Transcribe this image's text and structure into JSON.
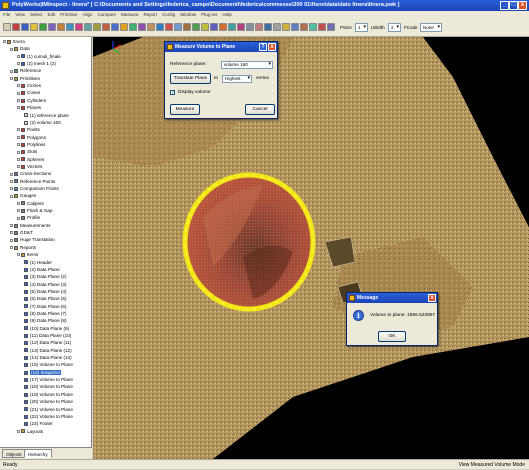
{
  "window": {
    "title": "PolyWorks|IMInspect - Itnera* [ C:\\Documents and Settings\\federica_campo\\Documenti\\federica\\commesse\\300 01\\fisno\\data\\dato Itnera\\Itnera.pwk ]",
    "minimize": "_",
    "maximize": "□",
    "close": "x"
  },
  "menu": [
    "File",
    "View",
    "Select",
    "Edit",
    "Primitive",
    "Align",
    "Compare",
    "Measure",
    "Report",
    "Config",
    "Window",
    "Plug-ins",
    "Help"
  ],
  "toolbar": {
    "psize_label": "PSize",
    "psize_value": "1",
    "lwidth_label": "LWidth",
    "lwidth_value": "2",
    "fcode_label": "FCode",
    "fcode_value": "None"
  },
  "tree": [
    {
      "label": "Itnera",
      "level": 0,
      "icon": "folder-icon",
      "color": "#c8a040"
    },
    {
      "label": "Data",
      "level": 1,
      "icon": "folder-icon",
      "color": "#c8a040"
    },
    {
      "label": "(1) cumuli_finale",
      "level": 2,
      "icon": "mesh-icon",
      "color": "#4060c0"
    },
    {
      "label": "(2) mesh 1 (2)",
      "level": 2,
      "icon": "mesh-icon",
      "color": "#4060c0"
    },
    {
      "label": "Reference",
      "level": 1,
      "icon": "reference-icon",
      "color": "#60a060"
    },
    {
      "label": "Primitives",
      "level": 1,
      "icon": "folder-icon",
      "color": "#c8a040"
    },
    {
      "label": "Circles",
      "level": 2,
      "icon": "circle-icon",
      "color": "#c04040"
    },
    {
      "label": "Cones",
      "level": 2,
      "icon": "cone-icon",
      "color": "#c04040"
    },
    {
      "label": "Cylinders",
      "level": 2,
      "icon": "cylinder-icon",
      "color": "#c04040"
    },
    {
      "label": "Planes",
      "level": 2,
      "icon": "plane-icon",
      "color": "#c04040"
    },
    {
      "label": "(1) reference plane",
      "level": 3,
      "icon": "plane-item-icon",
      "color": "#d8d8d8"
    },
    {
      "label": "(2) volume 160",
      "level": 3,
      "icon": "plane-item-icon",
      "color": "#d8d8d8"
    },
    {
      "label": "Points",
      "level": 2,
      "icon": "point-icon",
      "color": "#c04040"
    },
    {
      "label": "Polygons",
      "level": 2,
      "icon": "polygon-icon",
      "color": "#c04040"
    },
    {
      "label": "Polylines",
      "level": 2,
      "icon": "polyline-icon",
      "color": "#c04040"
    },
    {
      "label": "Slots",
      "level": 2,
      "icon": "slot-icon",
      "color": "#c04040"
    },
    {
      "label": "Spheres",
      "level": 2,
      "icon": "sphere-icon",
      "color": "#c04040"
    },
    {
      "label": "Vectors",
      "level": 2,
      "icon": "vector-icon",
      "color": "#c04040"
    },
    {
      "label": "Cross-Sections",
      "level": 1,
      "icon": "cross-section-icon",
      "color": "#4080c0"
    },
    {
      "label": "Reference Points",
      "level": 1,
      "icon": "reference-points-icon",
      "color": "#4080c0"
    },
    {
      "label": "Comparison Points",
      "level": 1,
      "icon": "comparison-points-icon",
      "color": "#4080c0"
    },
    {
      "label": "Gauges",
      "level": 1,
      "icon": "folder-icon",
      "color": "#c8a040"
    },
    {
      "label": "Calipers",
      "level": 2,
      "icon": "caliper-icon",
      "color": "#808080"
    },
    {
      "label": "Flush & Gap",
      "level": 2,
      "icon": "flush-gap-icon",
      "color": "#808080"
    },
    {
      "label": "Profile",
      "level": 2,
      "icon": "profile-icon",
      "color": "#808080"
    },
    {
      "label": "Measurements",
      "level": 1,
      "icon": "measurement-icon",
      "color": "#808080"
    },
    {
      "label": "GD&T",
      "level": 1,
      "icon": "gdt-icon",
      "color": "#808080"
    },
    {
      "label": "Huge Translation",
      "level": 1,
      "icon": "translation-icon",
      "color": "#808080"
    },
    {
      "label": "Reports",
      "level": 1,
      "icon": "folder-icon",
      "color": "#c8a040"
    },
    {
      "label": "Items",
      "level": 2,
      "icon": "folder-icon",
      "color": "#c8a040"
    },
    {
      "label": "(1) Header",
      "level": 3,
      "icon": "report-item-icon",
      "color": "#4060c0"
    },
    {
      "label": "(2) Data Plane",
      "level": 3,
      "icon": "report-item-icon",
      "color": "#4060c0"
    },
    {
      "label": "(3) Data Plane (2)",
      "level": 3,
      "icon": "report-item-icon",
      "color": "#4060c0"
    },
    {
      "label": "(4) Data Plane (3)",
      "level": 3,
      "icon": "report-item-icon",
      "color": "#4060c0"
    },
    {
      "label": "(5) Data Plane (4)",
      "level": 3,
      "icon": "report-item-icon",
      "color": "#4060c0"
    },
    {
      "label": "(6) Data Plane (5)",
      "level": 3,
      "icon": "report-item-icon",
      "color": "#4060c0"
    },
    {
      "label": "(7) Data Plane (6)",
      "level": 3,
      "icon": "report-item-icon",
      "color": "#4060c0"
    },
    {
      "label": "(8) Data Plane (7)",
      "level": 3,
      "icon": "report-item-icon",
      "color": "#4060c0"
    },
    {
      "label": "(9) Data Plane (8)",
      "level": 3,
      "icon": "report-item-icon",
      "color": "#4060c0"
    },
    {
      "label": "(10) Data Plane (9)",
      "level": 3,
      "icon": "report-item-icon",
      "color": "#4060c0"
    },
    {
      "label": "(11) Data Plane (10)",
      "level": 3,
      "icon": "report-item-icon",
      "color": "#4060c0"
    },
    {
      "label": "(12) Data Plane (11)",
      "level": 3,
      "icon": "report-item-icon",
      "color": "#4060c0"
    },
    {
      "label": "(13) Data Plane (12)",
      "level": 3,
      "icon": "report-item-icon",
      "color": "#4060c0"
    },
    {
      "label": "(14) Data Plane (13)",
      "level": 3,
      "icon": "report-item-icon",
      "color": "#4060c0"
    },
    {
      "label": "(15) Volume to Plane",
      "level": 3,
      "icon": "report-item-icon",
      "color": "#4060c0"
    },
    {
      "label": "(16) Snapshot",
      "level": 3,
      "icon": "snapshot-icon",
      "color": "#4060c0",
      "selected": true
    },
    {
      "label": "(17) Volume to Plane",
      "level": 3,
      "icon": "report-item-icon",
      "color": "#4060c0"
    },
    {
      "label": "(18) Volume to Plane",
      "level": 3,
      "icon": "report-item-icon",
      "color": "#4060c0"
    },
    {
      "label": "(19) Volume to Plane",
      "level": 3,
      "icon": "report-item-icon",
      "color": "#4060c0"
    },
    {
      "label": "(20) Volume to Plane",
      "level": 3,
      "icon": "report-item-icon",
      "color": "#4060c0"
    },
    {
      "label": "(21) Volume to Plane",
      "level": 3,
      "icon": "report-item-icon",
      "color": "#4060c0"
    },
    {
      "label": "(22) Volume to Plane",
      "level": 3,
      "icon": "report-item-icon",
      "color": "#4060c0"
    },
    {
      "label": "(23) Footer",
      "level": 3,
      "icon": "report-item-icon",
      "color": "#4060c0"
    },
    {
      "label": "Layouts",
      "level": 2,
      "icon": "folder-icon",
      "color": "#c8a040"
    }
  ],
  "panel_tabs": [
    "Objects",
    "Hierarchy"
  ],
  "measure_dialog": {
    "title": "Measure Volume to Plane",
    "reference_plane_label": "Reference plane:",
    "reference_plane_value": "volume 160",
    "translate_button": "Translate Plane",
    "to_label": "to",
    "highest_value": "Highest",
    "vertex_label": "vertex",
    "display_volume_label": "Display volume",
    "display_volume_checked": true,
    "measure_button": "Measure",
    "cancel_button": "Cancel",
    "help": "?",
    "close": "x"
  },
  "message_dialog": {
    "title": "Message",
    "text": "Volume to plane: 1596.523957",
    "ok_button": "OK",
    "close": "x"
  },
  "status": {
    "left": "Ready",
    "right": "View Measured Volume Mode"
  },
  "colors": {
    "terrain": "#b89a60",
    "volume_fill": "#a04a3a",
    "boundary": "#f2e614",
    "title_blue": "#1b45b8"
  }
}
